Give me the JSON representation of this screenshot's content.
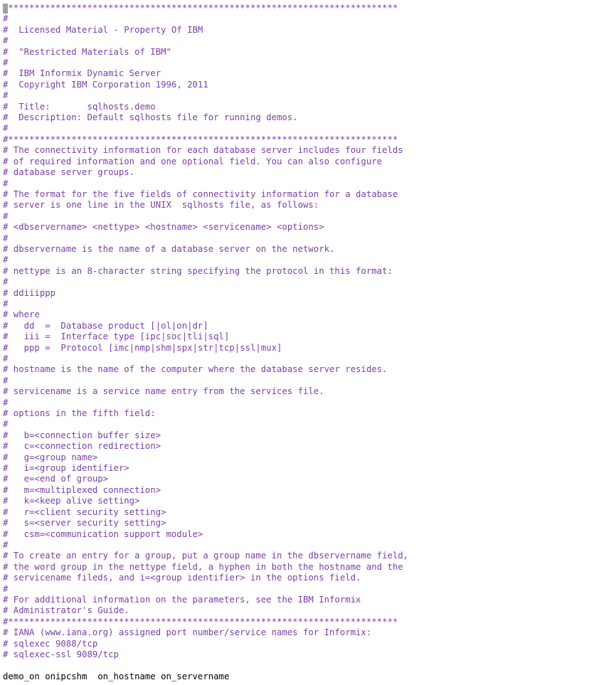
{
  "lines": [
    {
      "cls": "c",
      "text": "#**************************************************************************"
    },
    {
      "cls": "c",
      "text": "#"
    },
    {
      "cls": "c",
      "text": "#  Licensed Material - Property Of IBM"
    },
    {
      "cls": "c",
      "text": "#"
    },
    {
      "cls": "c",
      "text": "#  \"Restricted Materials of IBM\""
    },
    {
      "cls": "c",
      "text": "#"
    },
    {
      "cls": "c",
      "text": "#  IBM Informix Dynamic Server"
    },
    {
      "cls": "c",
      "text": "#  Copyright IBM Corporation 1996, 2011"
    },
    {
      "cls": "c",
      "text": "#"
    },
    {
      "cls": "c",
      "text": "#  Title:       sqlhosts.demo"
    },
    {
      "cls": "c",
      "text": "#  Description: Default sqlhosts file for running demos."
    },
    {
      "cls": "c",
      "text": "#"
    },
    {
      "cls": "c",
      "text": "#**************************************************************************"
    },
    {
      "cls": "c",
      "text": "# The connectivity information for each database server includes four fields"
    },
    {
      "cls": "c",
      "text": "# of required information and one optional field. You can also configure"
    },
    {
      "cls": "c",
      "text": "# database server groups."
    },
    {
      "cls": "c",
      "text": "#"
    },
    {
      "cls": "c",
      "text": "# The format for the five fields of connectivity information for a database"
    },
    {
      "cls": "c",
      "text": "# server is one line in the UNIX  sqlhosts file, as follows:"
    },
    {
      "cls": "c",
      "text": "#"
    },
    {
      "cls": "c",
      "text": "# <dbservername> <nettype> <hostname> <servicename> <options>"
    },
    {
      "cls": "c",
      "text": "#"
    },
    {
      "cls": "c",
      "text": "# dbservername is the name of a database server on the network."
    },
    {
      "cls": "c",
      "text": "#"
    },
    {
      "cls": "c",
      "text": "# nettype is an 8-character string specifying the protocol in this format:"
    },
    {
      "cls": "c",
      "text": "#"
    },
    {
      "cls": "c",
      "text": "# ddiiippp"
    },
    {
      "cls": "c",
      "text": "#"
    },
    {
      "cls": "c",
      "text": "# where"
    },
    {
      "cls": "c",
      "text": "#   dd  =  Database product [|ol|on|dr]"
    },
    {
      "cls": "c",
      "text": "#   iii =  Interface type [ipc|soc|tli|sql]"
    },
    {
      "cls": "c",
      "text": "#   ppp =  Protocol [imc|nmp|shm|spx|str|tcp|ssl|mux]"
    },
    {
      "cls": "c",
      "text": "#"
    },
    {
      "cls": "c",
      "text": "# hostname is the name of the computer where the database server resides."
    },
    {
      "cls": "c",
      "text": "#"
    },
    {
      "cls": "c",
      "text": "# servicename is a service name entry from the services file."
    },
    {
      "cls": "c",
      "text": "#"
    },
    {
      "cls": "c",
      "text": "# options in the fifth field:"
    },
    {
      "cls": "c",
      "text": "#"
    },
    {
      "cls": "c",
      "text": "#   b=<connection buffer size>"
    },
    {
      "cls": "c",
      "text": "#   c=<connection redirection>"
    },
    {
      "cls": "c",
      "text": "#   g=<group name>"
    },
    {
      "cls": "c",
      "text": "#   i=<group identifier>"
    },
    {
      "cls": "c",
      "text": "#   e=<end of group>"
    },
    {
      "cls": "c",
      "text": "#   m=<multiplexed connection>"
    },
    {
      "cls": "c",
      "text": "#   k=<keep alive setting>"
    },
    {
      "cls": "c",
      "text": "#   r=<client security setting>"
    },
    {
      "cls": "c",
      "text": "#   s=<server security setting>"
    },
    {
      "cls": "c",
      "text": "#   csm=<communication support module>"
    },
    {
      "cls": "c",
      "text": "#"
    },
    {
      "cls": "c",
      "text": "# To create an entry for a group, put a group name in the dbservername field,"
    },
    {
      "cls": "c",
      "text": "# the word group in the nettype field, a hyphen in both the hostname and the"
    },
    {
      "cls": "c",
      "text": "# servicename fileds, and i=<group identifier> in the options field."
    },
    {
      "cls": "c",
      "text": "#"
    },
    {
      "cls": "c",
      "text": "# For additional information on the parameters, see the IBM Informix"
    },
    {
      "cls": "c",
      "text": "# Administrator's Guide."
    },
    {
      "cls": "c",
      "text": "#**************************************************************************"
    },
    {
      "cls": "c",
      "text": "# IANA (www.iana.org) assigned port number/service names for Informix:"
    },
    {
      "cls": "c",
      "text": "# sqlexec 9088/tcp"
    },
    {
      "cls": "c",
      "text": "# sqlexec-ssl 9089/tcp"
    },
    {
      "cls": "t",
      "text": ""
    },
    {
      "cls": "t",
      "text": "demo_on onipcshm  on_hostname on_servername"
    }
  ]
}
